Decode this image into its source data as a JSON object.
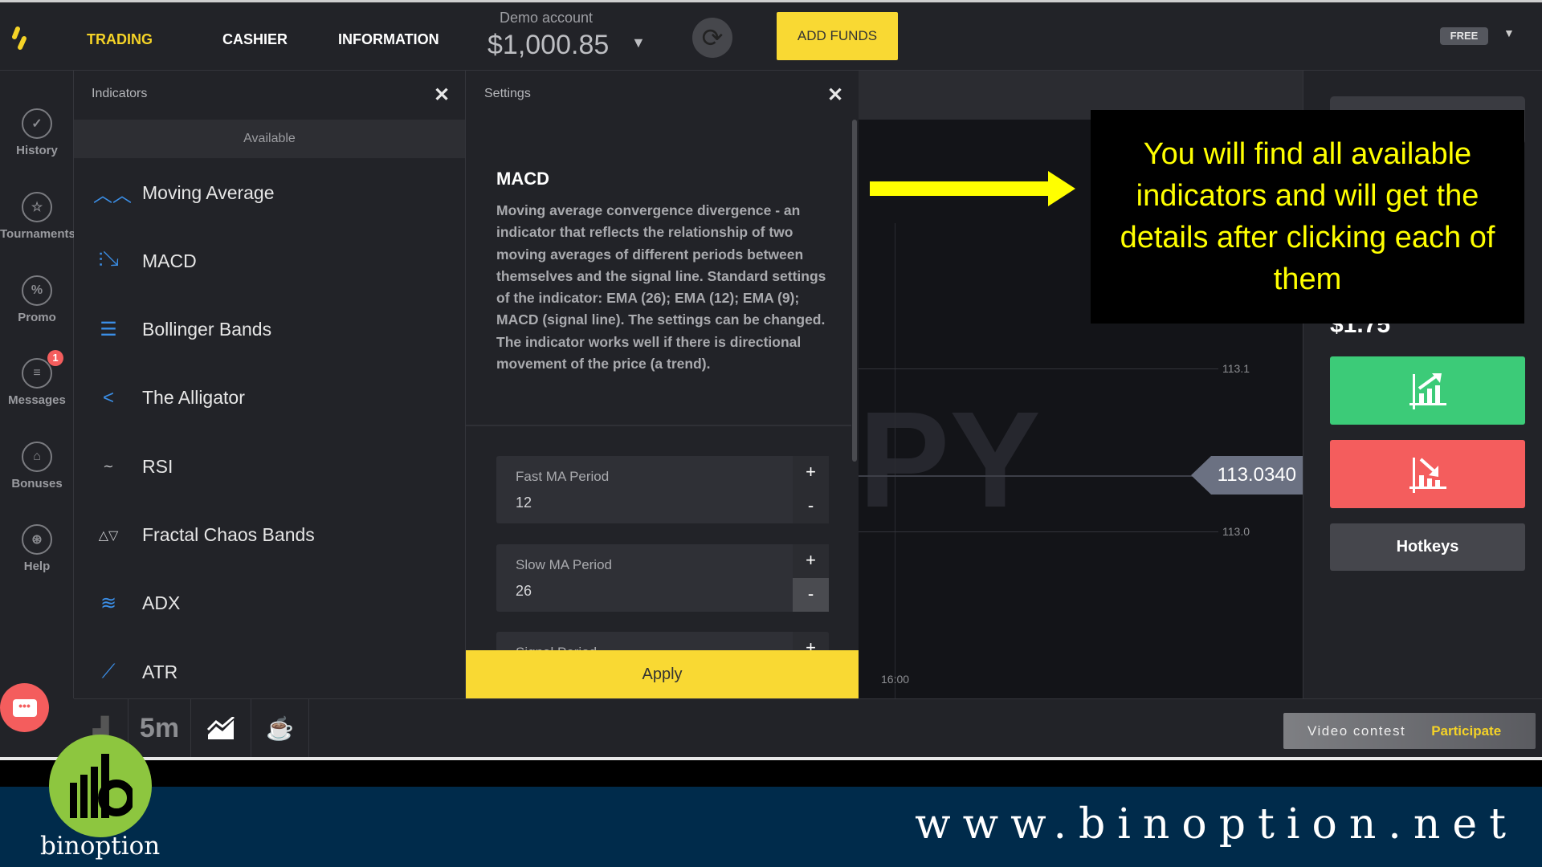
{
  "header": {
    "nav": [
      "TRADING",
      "CASHIER",
      "INFORMATION"
    ],
    "account_label": "Demo account",
    "balance": "$1,000.85",
    "add_funds": "ADD FUNDS",
    "plan_badge": "FREE"
  },
  "sidebar": {
    "items": [
      {
        "label": "History",
        "icon": "check-circle-icon"
      },
      {
        "label": "Tournaments",
        "icon": "trophy-icon"
      },
      {
        "label": "Promo",
        "icon": "percent-icon"
      },
      {
        "label": "Messages",
        "icon": "messages-icon",
        "badge": "1"
      },
      {
        "label": "Bonuses",
        "icon": "gift-icon"
      },
      {
        "label": "Help",
        "icon": "lifebuoy-icon"
      }
    ]
  },
  "indicators": {
    "title": "Indicators",
    "section": "Available",
    "items": [
      {
        "label": "Moving Average",
        "icon": "moving-average-icon"
      },
      {
        "label": "MACD",
        "icon": "macd-icon"
      },
      {
        "label": "Bollinger Bands",
        "icon": "bollinger-icon"
      },
      {
        "label": "The Alligator",
        "icon": "alligator-icon"
      },
      {
        "label": "RSI",
        "icon": "rsi-icon"
      },
      {
        "label": "Fractal Chaos Bands",
        "icon": "fractal-icon"
      },
      {
        "label": "ADX",
        "icon": "adx-icon"
      },
      {
        "label": "ATR",
        "icon": "atr-icon"
      }
    ]
  },
  "settings": {
    "title": "Settings",
    "indicator": "MACD",
    "description": "Moving average convergence divergence - an indicator that reflects the relationship of two moving averages of different periods between themselves and the signal line. Standard settings of the indicator: EMA (26); EMA (12); EMA (9); MACD (signal line). The settings can be changed. The indicator works well if there is directional movement of the price (a trend).",
    "fields": [
      {
        "label": "Fast MA Period",
        "value": "12"
      },
      {
        "label": "Slow MA Period",
        "value": "26"
      },
      {
        "label": "Signal Period",
        "value": ""
      }
    ],
    "plus": "+",
    "minus": "-",
    "apply": "Apply"
  },
  "chart": {
    "price_labels": [
      "113.1",
      "113.0"
    ],
    "current_price": "113.0340",
    "time_label": "16:00",
    "watermark": "PY"
  },
  "callout": {
    "text": "You will find all available indicators and will get the details after clicking each of them",
    "color": "#ffff00"
  },
  "right_panel": {
    "payout": "$1.75",
    "hotkeys": "Hotkeys",
    "call_color": "#3ccb78",
    "put_color": "#f45d5d"
  },
  "toolbar": {
    "timeframe": "5m",
    "video_contest": "Video contest",
    "participate": "Participate"
  },
  "footer": {
    "brand": "binoption",
    "url": "www.binoption.net"
  }
}
